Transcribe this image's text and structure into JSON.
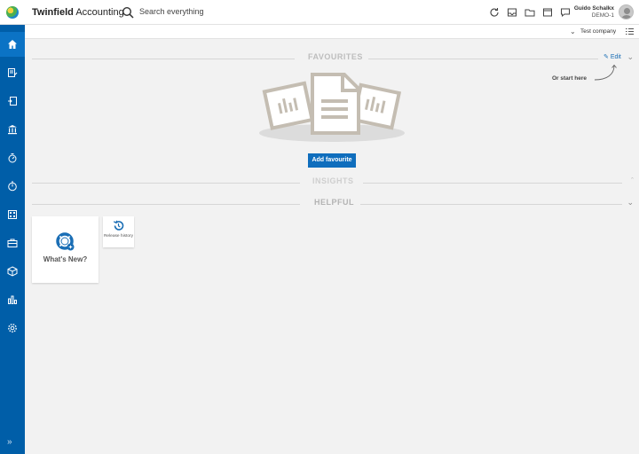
{
  "header": {
    "brand_bold": "Twinfield",
    "brand_rest": "Accounting",
    "search_placeholder": "Search everything",
    "user_name": "Guido Schalkx",
    "user_env": "DEMO-1",
    "icons": [
      "refresh-icon",
      "inbox-icon",
      "folder-icon",
      "window-icon",
      "chat-icon"
    ]
  },
  "sidebar": {
    "items": [
      {
        "icon": "home-icon",
        "active": true
      },
      {
        "icon": "invoice-edit-icon"
      },
      {
        "icon": "document-out-icon"
      },
      {
        "icon": "bank-icon"
      },
      {
        "icon": "stopwatch-icon"
      },
      {
        "icon": "timer-icon"
      },
      {
        "icon": "calculator-icon"
      },
      {
        "icon": "briefcase-icon"
      },
      {
        "icon": "box-icon"
      },
      {
        "icon": "bar-chart-icon"
      },
      {
        "icon": "settings-icon"
      }
    ],
    "expand_glyph": "»"
  },
  "company_bar": {
    "company": "Test company"
  },
  "favourites": {
    "title": "FAVOURITES",
    "edit_label": "Edit",
    "start_here": "Or start here",
    "add_button": "Add favourite"
  },
  "insights": {
    "title": "INSIGHTS"
  },
  "helpful": {
    "title": "HELPFUL",
    "tiles": [
      {
        "label": "What's New?",
        "icon": "lifebuoy-icon"
      },
      {
        "label": "Release history",
        "icon": "history-icon"
      }
    ]
  },
  "colors": {
    "sidebar": "#005ea8",
    "accent": "#0f6ebd",
    "background": "#f2f2f2"
  }
}
